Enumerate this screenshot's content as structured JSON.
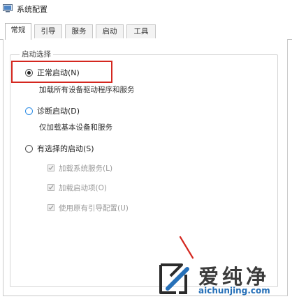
{
  "window": {
    "title": "系统配置"
  },
  "tabs": [
    {
      "label": "常规",
      "active": true
    },
    {
      "label": "引导"
    },
    {
      "label": "服务"
    },
    {
      "label": "启动"
    },
    {
      "label": "工具"
    }
  ],
  "startup_group": {
    "legend": "启动选择",
    "options": [
      {
        "label": "正常启动(N)",
        "description": "加载所有设备驱动程序和服务",
        "checked": true
      },
      {
        "label": "诊断启动(D)",
        "description": "仅加载基本设备和服务",
        "checked": false
      },
      {
        "label": "有选择的启动(S)",
        "checked": false
      }
    ],
    "selective_items": [
      {
        "label": "加载系统服务(L)",
        "checked": true,
        "enabled": false
      },
      {
        "label": "加载启动项(O)",
        "checked": true,
        "enabled": false
      },
      {
        "label": "使用原有引导配置(U)",
        "checked": true,
        "enabled": false
      }
    ]
  },
  "annotation": {
    "highlight_color": "#d4271f"
  },
  "watermark": {
    "name": "爱纯净",
    "url": "aichunjing.com",
    "url_color": "#2670b8"
  }
}
